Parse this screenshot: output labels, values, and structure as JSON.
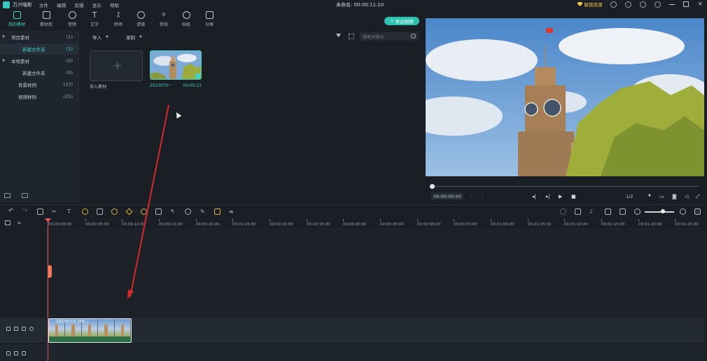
{
  "titlebar": {
    "app_name": "万兴喵影",
    "menus": [
      "文件",
      "编辑",
      "剪辑",
      "显示",
      "帮助"
    ],
    "project_title": "未命名: 00:00:11:10",
    "vip_label": "解锁资源"
  },
  "media_tabs": [
    {
      "label": "我的素材",
      "icon": "folder-open-icon"
    },
    {
      "label": "素材库",
      "icon": "folder-icon"
    },
    {
      "label": "音频",
      "icon": "music-note-icon"
    },
    {
      "label": "文字",
      "icon": "text-icon"
    },
    {
      "label": "转场",
      "icon": "transition-icon"
    },
    {
      "label": "滤镜",
      "icon": "filter-circles-icon"
    },
    {
      "label": "特效",
      "icon": "sparkle-icon"
    },
    {
      "label": "贴纸",
      "icon": "sticker-icon"
    },
    {
      "label": "分屏",
      "icon": "split-screen-icon"
    }
  ],
  "export_button": "导出视频",
  "tree": [
    {
      "label": "项目素材",
      "count": "(1)",
      "expanded": true
    },
    {
      "label": "新建文件夹",
      "count": "(1)",
      "selected": true
    },
    {
      "label": "本地素材",
      "count": "(0)",
      "expanded": true
    },
    {
      "label": "新建文件夹",
      "count": "(0)"
    },
    {
      "label": "背景样例",
      "count": "(37)"
    },
    {
      "label": "视频样例",
      "count": "(25)"
    }
  ],
  "media_panel": {
    "import_dropdown": "导入",
    "record_dropdown": "录制",
    "search_placeholder": "搜索关键词",
    "import_tile_label": "导入素材",
    "clip_name": "2023070···",
    "clip_duration": "00:00:11"
  },
  "preview": {
    "timecode": "00:00:00:00",
    "ratio": "1/2"
  },
  "ruler_ticks": [
    "00:00:00:00",
    "00:00:05:00",
    "00:00:10:00",
    "00:00:15:00",
    "00:00:20:00",
    "00:00:25:00",
    "00:00:30:00",
    "00:00:35:00",
    "00:00:40:00",
    "00:00:45:00",
    "00:00:50:00",
    "00:00:55:00",
    "00:01:00:00",
    "00:01:05:00",
    "00:01:10:00",
    "00:01:15:00",
    "00:01:20:00",
    "00:01:25:00"
  ],
  "timeline": {
    "clip_name": "20230714_185..."
  },
  "colors": {
    "accent": "#3ed1c9",
    "export_bg": "#2fc3b1",
    "playhead": "#e05555",
    "vip_gold": "#f0c24a"
  }
}
